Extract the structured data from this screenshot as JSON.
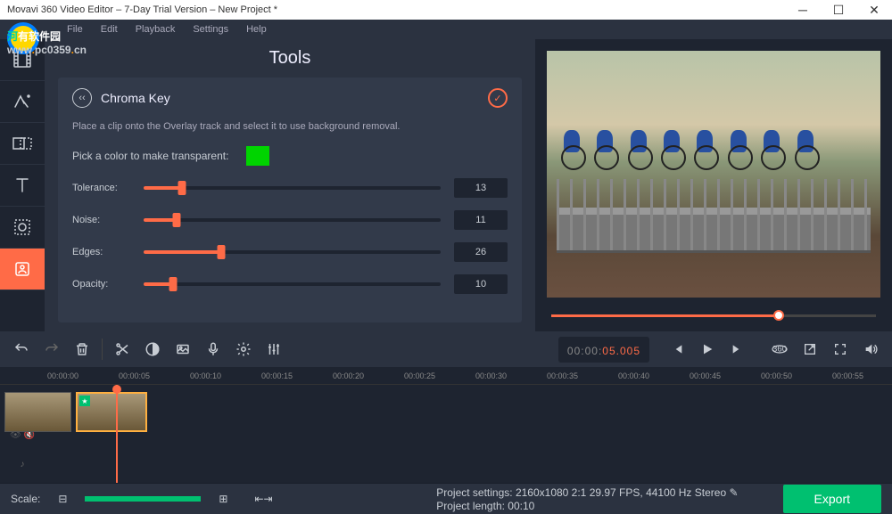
{
  "window": {
    "title": "Movavi 360 Video Editor – 7-Day Trial Version – New Project *"
  },
  "watermark": {
    "line1a": "河",
    "line1b": "有软件园",
    "line2a": "www",
    "line2b": ".",
    "line2c": "pc0359",
    "line2d": ".",
    "line2e": "cn"
  },
  "menu": {
    "file": "File",
    "edit": "Edit",
    "playback": "Playback",
    "settings": "Settings",
    "help": "Help"
  },
  "tools": {
    "title": "Tools",
    "panel_name": "Chroma Key",
    "info": "Place a clip onto the Overlay track and select it to use background removal.",
    "pick_label": "Pick a color to make transparent:",
    "sliders": {
      "tolerance": {
        "label": "Tolerance:",
        "value": "13",
        "pct": 13
      },
      "noise": {
        "label": "Noise:",
        "value": "11",
        "pct": 11
      },
      "edges": {
        "label": "Edges:",
        "value": "26",
        "pct": 26
      },
      "opacity": {
        "label": "Opacity:",
        "value": "10",
        "pct": 10
      }
    }
  },
  "timecode": {
    "gray": "00:00:",
    "red": "05.005"
  },
  "ruler": [
    "00:00:00",
    "00:00:05",
    "00:00:10",
    "00:00:15",
    "00:00:20",
    "00:00:25",
    "00:00:30",
    "00:00:35",
    "00:00:40",
    "00:00:45",
    "00:00:50",
    "00:00:55"
  ],
  "footer": {
    "scale": "Scale:",
    "settings_label": "Project settings:",
    "settings_val": "2160x1080 2:1 29.97 FPS, 44100 Hz Stereo",
    "length_label": "Project length:",
    "length_val": "00:10",
    "export": "Export"
  }
}
